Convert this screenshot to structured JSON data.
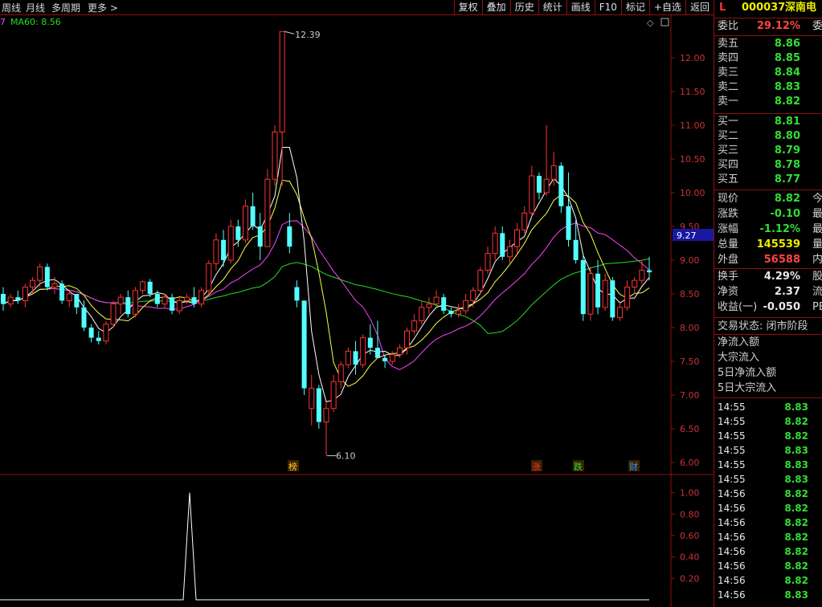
{
  "toolbar": {
    "left": [
      "周线",
      "月线",
      "多周期",
      "更多"
    ],
    "right": [
      "复权",
      "叠加",
      "历史",
      "统计",
      "画线",
      "F10",
      "标记",
      "+自选",
      "返回"
    ]
  },
  "indicator_legend": {
    "prefix": "7",
    "ma60": "MA60: 8.56"
  },
  "price_markers": {
    "high": "12.39",
    "low": "6.10",
    "current_tag": "9.27"
  },
  "event_markers": [
    "榜",
    "涨",
    "跌",
    "财"
  ],
  "colors": {
    "up": "#ff3333",
    "down": "#54ffff",
    "ma5": "#ffffff",
    "ma10": "#ffff44",
    "ma20": "#ff44ff",
    "ma60": "#22dd22",
    "border": "#8a1212"
  },
  "stock": {
    "flag": "L",
    "code": "000037",
    "name": "深南电"
  },
  "quote": {
    "weibi": {
      "label": "委比",
      "value": "29.12%",
      "extra": "委"
    },
    "asks": [
      {
        "label": "卖五",
        "price": "8.86"
      },
      {
        "label": "卖四",
        "price": "8.85"
      },
      {
        "label": "卖三",
        "price": "8.84"
      },
      {
        "label": "卖二",
        "price": "8.83"
      },
      {
        "label": "卖一",
        "price": "8.82"
      }
    ],
    "bids": [
      {
        "label": "买一",
        "price": "8.81"
      },
      {
        "label": "买二",
        "price": "8.80"
      },
      {
        "label": "买三",
        "price": "8.79"
      },
      {
        "label": "买四",
        "price": "8.78"
      },
      {
        "label": "买五",
        "price": "8.77"
      }
    ],
    "stats": [
      {
        "label": "现价",
        "value": "8.82",
        "extra": "今"
      },
      {
        "label": "涨跌",
        "value": "-0.10",
        "extra": "最"
      },
      {
        "label": "涨幅",
        "value": "-1.12%",
        "extra": "最"
      },
      {
        "label": "总量",
        "value": "145539",
        "extra": "量"
      },
      {
        "label": "外盘",
        "value": "56588",
        "extra": "内"
      }
    ],
    "stats2": [
      {
        "label": "换手",
        "value": "4.29%",
        "extra": "股"
      },
      {
        "label": "净资",
        "value": "2.37",
        "extra": "流"
      },
      {
        "label": "收益(一)",
        "value": "-0.050",
        "extra": "PE"
      }
    ],
    "status": "交易状态: 闭市阶段",
    "flows": [
      "净流入额",
      "大宗流入",
      "5日净流入额",
      "5日大宗流入"
    ],
    "ticks": [
      {
        "time": "14:55",
        "price": "8.83"
      },
      {
        "time": "14:55",
        "price": "8.82"
      },
      {
        "time": "14:55",
        "price": "8.82"
      },
      {
        "time": "14:55",
        "price": "8.83"
      },
      {
        "time": "14:55",
        "price": "8.83"
      },
      {
        "time": "14:55",
        "price": "8.83"
      },
      {
        "time": "14:56",
        "price": "8.82"
      },
      {
        "time": "14:56",
        "price": "8.82"
      },
      {
        "time": "14:56",
        "price": "8.82"
      },
      {
        "time": "14:56",
        "price": "8.82"
      },
      {
        "time": "14:56",
        "price": "8.82"
      },
      {
        "time": "14:56",
        "price": "8.82"
      },
      {
        "time": "14:56",
        "price": "8.82"
      },
      {
        "time": "14:56",
        "price": "8.83"
      }
    ]
  },
  "chart_data": {
    "type": "candlestick",
    "y_ticks": [
      "12.00",
      "11.50",
      "11.00",
      "10.50",
      "10.00",
      "9.50",
      "9.00",
      "8.50",
      "8.00",
      "7.50",
      "7.00",
      "6.50",
      "6.00"
    ],
    "ylim": [
      5.95,
      12.5
    ],
    "candles": [
      [
        8.5,
        8.6,
        8.25,
        8.35
      ],
      [
        8.35,
        8.5,
        8.3,
        8.45
      ],
      [
        8.45,
        8.55,
        8.35,
        8.4
      ],
      [
        8.4,
        8.65,
        8.3,
        8.6
      ],
      [
        8.6,
        8.75,
        8.5,
        8.7
      ],
      [
        8.7,
        8.95,
        8.6,
        8.9
      ],
      [
        8.9,
        8.95,
        8.55,
        8.6
      ],
      [
        8.6,
        8.75,
        8.5,
        8.65
      ],
      [
        8.65,
        8.7,
        8.35,
        8.4
      ],
      [
        8.4,
        8.55,
        8.3,
        8.5
      ],
      [
        8.5,
        8.5,
        8.2,
        8.3
      ],
      [
        8.3,
        8.4,
        7.95,
        8.0
      ],
      [
        8.0,
        8.05,
        7.78,
        7.85
      ],
      [
        7.85,
        7.95,
        7.75,
        7.8
      ],
      [
        7.8,
        8.1,
        7.75,
        8.05
      ],
      [
        8.05,
        8.4,
        8.0,
        8.35
      ],
      [
        8.35,
        8.5,
        8.2,
        8.45
      ],
      [
        8.45,
        8.55,
        8.15,
        8.2
      ],
      [
        8.2,
        8.6,
        8.15,
        8.55
      ],
      [
        8.55,
        8.7,
        8.5,
        8.68
      ],
      [
        8.68,
        8.72,
        8.45,
        8.5
      ],
      [
        8.5,
        8.55,
        8.3,
        8.35
      ],
      [
        8.35,
        8.5,
        8.3,
        8.45
      ],
      [
        8.45,
        8.5,
        8.2,
        8.25
      ],
      [
        8.25,
        8.45,
        8.2,
        8.4
      ],
      [
        8.4,
        8.5,
        8.35,
        8.45
      ],
      [
        8.45,
        8.6,
        8.3,
        8.35
      ],
      [
        8.35,
        8.6,
        8.3,
        8.55
      ],
      [
        8.55,
        9.0,
        8.5,
        8.95
      ],
      [
        8.95,
        9.4,
        8.85,
        9.3
      ],
      [
        9.3,
        9.45,
        8.9,
        9.0
      ],
      [
        9.0,
        9.6,
        8.95,
        9.5
      ],
      [
        9.5,
        9.6,
        9.2,
        9.3
      ],
      [
        9.3,
        9.9,
        9.25,
        9.8
      ],
      [
        9.8,
        10.0,
        9.45,
        9.5
      ],
      [
        9.5,
        9.7,
        9.0,
        9.2
      ],
      [
        9.2,
        10.35,
        9.2,
        10.2
      ],
      [
        10.2,
        11.0,
        10.1,
        10.9
      ],
      [
        10.9,
        12.39,
        10.1,
        12.39
      ],
      [
        9.5,
        9.7,
        9.1,
        9.2
      ],
      [
        8.6,
        8.7,
        8.3,
        8.4
      ],
      [
        8.4,
        8.4,
        7.0,
        7.1
      ],
      [
        6.8,
        7.3,
        6.55,
        7.1
      ],
      [
        7.1,
        7.15,
        6.5,
        6.6
      ],
      [
        6.6,
        6.9,
        6.1,
        6.8
      ],
      [
        6.8,
        7.3,
        6.75,
        7.2
      ],
      [
        7.2,
        7.5,
        7.1,
        7.45
      ],
      [
        7.45,
        7.7,
        7.4,
        7.65
      ],
      [
        7.65,
        7.8,
        7.3,
        7.45
      ],
      [
        7.45,
        7.9,
        7.4,
        7.85
      ],
      [
        7.85,
        8.05,
        7.6,
        7.7
      ],
      [
        7.7,
        8.1,
        7.55,
        7.55
      ],
      [
        7.55,
        7.6,
        7.4,
        7.5
      ],
      [
        7.5,
        7.65,
        7.45,
        7.6
      ],
      [
        7.6,
        7.75,
        7.55,
        7.7
      ],
      [
        7.7,
        8.0,
        7.6,
        7.95
      ],
      [
        7.95,
        8.2,
        7.9,
        8.1
      ],
      [
        8.1,
        8.4,
        8.05,
        8.3
      ],
      [
        8.3,
        8.45,
        8.2,
        8.35
      ],
      [
        8.35,
        8.55,
        8.3,
        8.45
      ],
      [
        8.45,
        8.5,
        8.2,
        8.25
      ],
      [
        8.25,
        8.3,
        8.15,
        8.2
      ],
      [
        8.2,
        8.35,
        8.15,
        8.25
      ],
      [
        8.25,
        8.5,
        8.2,
        8.4
      ],
      [
        8.4,
        8.6,
        8.3,
        8.55
      ],
      [
        8.55,
        8.9,
        8.5,
        8.85
      ],
      [
        8.85,
        9.2,
        8.8,
        9.1
      ],
      [
        9.1,
        9.5,
        9.0,
        9.4
      ],
      [
        9.4,
        9.5,
        9.0,
        9.05
      ],
      [
        9.05,
        9.3,
        8.95,
        9.2
      ],
      [
        9.2,
        9.55,
        9.1,
        9.45
      ],
      [
        9.45,
        9.8,
        9.4,
        9.7
      ],
      [
        9.7,
        10.4,
        9.65,
        10.25
      ],
      [
        10.25,
        10.3,
        9.9,
        10.0
      ],
      [
        10.0,
        11.0,
        9.95,
        10.2
      ],
      [
        10.2,
        10.6,
        10.1,
        10.4
      ],
      [
        10.4,
        10.45,
        9.7,
        9.8
      ],
      [
        9.8,
        10.3,
        9.2,
        9.3
      ],
      [
        9.3,
        9.6,
        8.95,
        9.0
      ],
      [
        9.0,
        9.1,
        8.1,
        8.2
      ],
      [
        8.2,
        8.9,
        8.1,
        8.8
      ],
      [
        8.8,
        9.0,
        8.2,
        8.3
      ],
      [
        8.3,
        8.8,
        8.25,
        8.7
      ],
      [
        8.7,
        8.75,
        8.1,
        8.15
      ],
      [
        8.15,
        8.4,
        8.1,
        8.3
      ],
      [
        8.3,
        8.7,
        8.25,
        8.6
      ],
      [
        8.6,
        8.75,
        8.5,
        8.7
      ],
      [
        8.7,
        9.0,
        8.65,
        8.85
      ],
      [
        8.85,
        9.05,
        8.7,
        8.82
      ]
    ],
    "series": [
      {
        "name": "MA60",
        "value": 8.56
      }
    ],
    "volume_axis": {
      "ticks": [
        "1.00",
        "0.80",
        "0.60",
        "0.40",
        "0.20"
      ],
      "ylim": [
        0,
        1.05
      ]
    },
    "volume_spike": {
      "index": 39,
      "value": 1.0
    }
  }
}
